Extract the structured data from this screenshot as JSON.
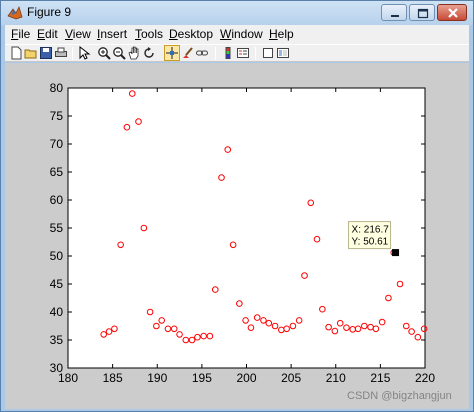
{
  "window": {
    "title": "Figure 9"
  },
  "menu": [
    "File",
    "Edit",
    "View",
    "Insert",
    "Tools",
    "Desktop",
    "Window",
    "Help"
  ],
  "toolbar": {
    "icons": [
      "new-figure-icon",
      "open-file-icon",
      "save-icon",
      "print-icon",
      "edit-plot-icon",
      "zoom-in-icon",
      "zoom-out-icon",
      "pan-icon",
      "rotate-3d-icon",
      "data-cursor-icon",
      "brush-icon",
      "link-plot-icon",
      "colorbar-icon",
      "legend-icon",
      "hide-plot-tools-icon",
      "show-plot-tools-icon"
    ]
  },
  "datatip": {
    "x_label": "X: 216.7",
    "y_label": "Y: 50.61",
    "x": 216.7,
    "y": 50.61
  },
  "watermark": "CSDN @bigzhangjun",
  "colors": {
    "marker": "#ff0000",
    "axes_bg": "#ffffff",
    "figure_bg": "#cccccc"
  },
  "chart_data": {
    "type": "scatter",
    "title": "",
    "xlabel": "",
    "ylabel": "",
    "xlim": [
      180,
      220
    ],
    "ylim": [
      30,
      80
    ],
    "xticks": [
      180,
      185,
      190,
      195,
      200,
      205,
      210,
      215,
      220
    ],
    "yticks": [
      30,
      35,
      40,
      45,
      50,
      55,
      60,
      65,
      70,
      75,
      80
    ],
    "marker": "circle",
    "grid": false,
    "series": [
      {
        "color": "#ff0000",
        "x": [
          184,
          184.6,
          185.2,
          185.9,
          186.6,
          187.2,
          187.9,
          188.5,
          189.2,
          189.9,
          190.5,
          191.2,
          191.9,
          192.5,
          193.2,
          193.9,
          194.5,
          195.2,
          195.9,
          196.5,
          197.2,
          197.9,
          198.5,
          199.2,
          199.9,
          200.5,
          201.2,
          201.9,
          202.5,
          203.2,
          203.9,
          204.5,
          205.2,
          205.9,
          206.5,
          207.2,
          207.9,
          208.5,
          209.2,
          209.9,
          210.5,
          211.2,
          211.9,
          212.5,
          213.2,
          213.9,
          214.5,
          215.2,
          215.9,
          216.5,
          217.2,
          217.9,
          218.5,
          219.2,
          219.9
        ],
        "y": [
          36,
          36.5,
          37,
          52,
          73,
          79,
          74,
          55,
          40,
          37.5,
          38.5,
          37,
          37,
          36,
          35,
          35,
          35.5,
          35.7,
          35.7,
          44,
          64,
          69,
          52,
          41.5,
          38.5,
          37.2,
          39,
          38.5,
          38,
          37.5,
          36.8,
          37,
          37.5,
          38.5,
          46.5,
          59.5,
          53,
          40.5,
          37.3,
          36.6,
          38,
          37.2,
          36.9,
          37,
          37.5,
          37.3,
          37,
          38.2,
          42.5,
          50.6,
          45,
          37.5,
          36.5,
          35.5,
          37
        ]
      }
    ]
  }
}
